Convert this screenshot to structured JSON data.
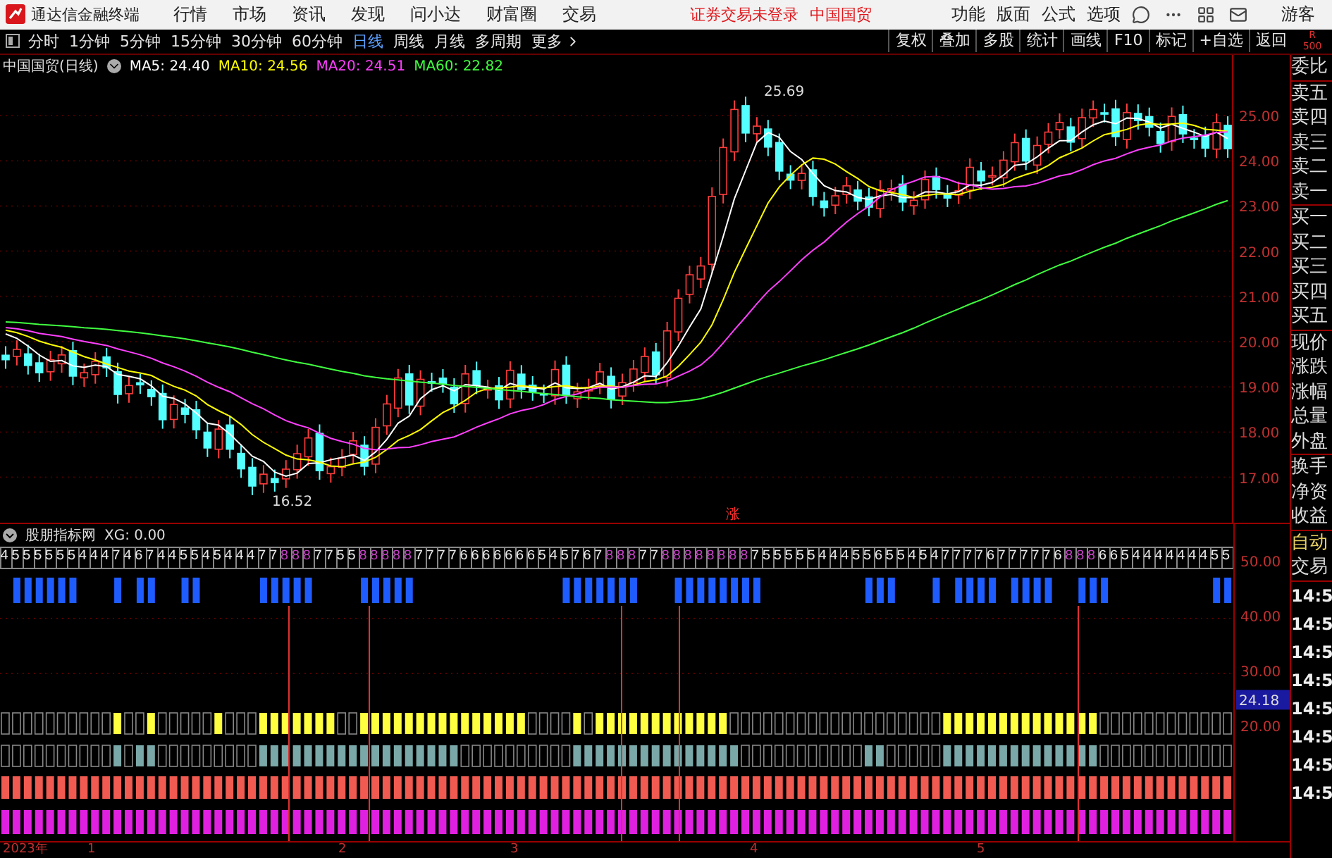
{
  "top_bar": {
    "app_title": "通达信金融终端",
    "menus": [
      "行情",
      "市场",
      "资讯",
      "发现",
      "问小达",
      "财富圈",
      "交易"
    ],
    "notices": [
      "证券交易未登录",
      "中国国贸"
    ],
    "tools": [
      "功能",
      "版面",
      "公式",
      "选项"
    ],
    "user": "游客"
  },
  "period_bar": {
    "periods": [
      {
        "label": "分时",
        "selected": false
      },
      {
        "label": "1分钟",
        "selected": false
      },
      {
        "label": "5分钟",
        "selected": false
      },
      {
        "label": "15分钟",
        "selected": false
      },
      {
        "label": "30分钟",
        "selected": false
      },
      {
        "label": "60分钟",
        "selected": false
      },
      {
        "label": "日线",
        "selected": true
      },
      {
        "label": "周线",
        "selected": false
      },
      {
        "label": "月线",
        "selected": false
      },
      {
        "label": "多周期",
        "selected": false
      },
      {
        "label": "更多",
        "selected": false
      }
    ],
    "actions": [
      "复权",
      "叠加",
      "多股",
      "统计",
      "画线",
      "F10",
      "标记",
      "+自选",
      "返回"
    ],
    "corner": [
      "R",
      "500"
    ]
  },
  "price_chart": {
    "title": "中国国贸(日线)",
    "ma": [
      {
        "label": "MA5: 24.40",
        "color": "#ffffff"
      },
      {
        "label": "MA10: 24.56",
        "color": "#ffff00"
      },
      {
        "label": "MA20: 24.51",
        "color": "#ff40ff"
      },
      {
        "label": "MA60: 22.82",
        "color": "#40ff40"
      }
    ],
    "high_label": "25.69",
    "low_label": "16.52",
    "marker": "涨",
    "y_ticks": [
      "25.00",
      "24.00",
      "23.00",
      "22.00",
      "21.00",
      "20.00",
      "19.00",
      "18.00",
      "17.00"
    ]
  },
  "indicator": {
    "name": "股朋指标网",
    "value": "XG: 0.00",
    "digit_runs": [
      {
        "text": "4555555444746744554544477",
        "highlight": false
      },
      {
        "text": "888",
        "highlight": true
      },
      {
        "text": "7755",
        "highlight": false
      },
      {
        "text": "88888",
        "highlight": true
      },
      {
        "text": "77776666666545767",
        "highlight": false
      },
      {
        "text": "888",
        "highlight": true
      },
      {
        "text": "77",
        "highlight": false
      },
      {
        "text": "88888888",
        "highlight": true
      },
      {
        "text": "7555554445565545477776777776",
        "highlight": false
      },
      {
        "text": "888",
        "highlight": true
      },
      {
        "text": "665444444455",
        "highlight": false
      }
    ],
    "y_ticks": [
      "50.00",
      "40.00",
      "30.00",
      "20.00"
    ],
    "current": "24.18"
  },
  "date_axis": [
    "2023年",
    "1",
    "2",
    "3",
    "4",
    "5"
  ],
  "side_panel": {
    "groups": [
      [
        {
          "label": "委比",
          "accent": false
        }
      ],
      [
        {
          "label": "卖五",
          "accent": false
        },
        {
          "label": "卖四",
          "accent": false
        },
        {
          "label": "卖三",
          "accent": false
        },
        {
          "label": "卖二",
          "accent": false
        },
        {
          "label": "卖一",
          "accent": false
        }
      ],
      [
        {
          "label": "买一",
          "accent": false
        },
        {
          "label": "买二",
          "accent": false
        },
        {
          "label": "买三",
          "accent": false
        },
        {
          "label": "买四",
          "accent": false
        },
        {
          "label": "买五",
          "accent": false
        }
      ],
      [
        {
          "label": "现价",
          "accent": false
        },
        {
          "label": "涨跌",
          "accent": false
        },
        {
          "label": "涨幅",
          "accent": false
        },
        {
          "label": "总量",
          "accent": false
        },
        {
          "label": "外盘",
          "accent": false
        }
      ],
      [
        {
          "label": "换手",
          "accent": false
        },
        {
          "label": "净资",
          "accent": false
        },
        {
          "label": "收益",
          "accent": false
        }
      ],
      [
        {
          "label": "自动",
          "accent": true
        },
        {
          "label": "交易",
          "accent": false
        }
      ]
    ],
    "times": [
      "14:5",
      "14:5",
      "14:5",
      "14:5",
      "14:5",
      "14:5",
      "14:5",
      "14:5"
    ]
  }
}
